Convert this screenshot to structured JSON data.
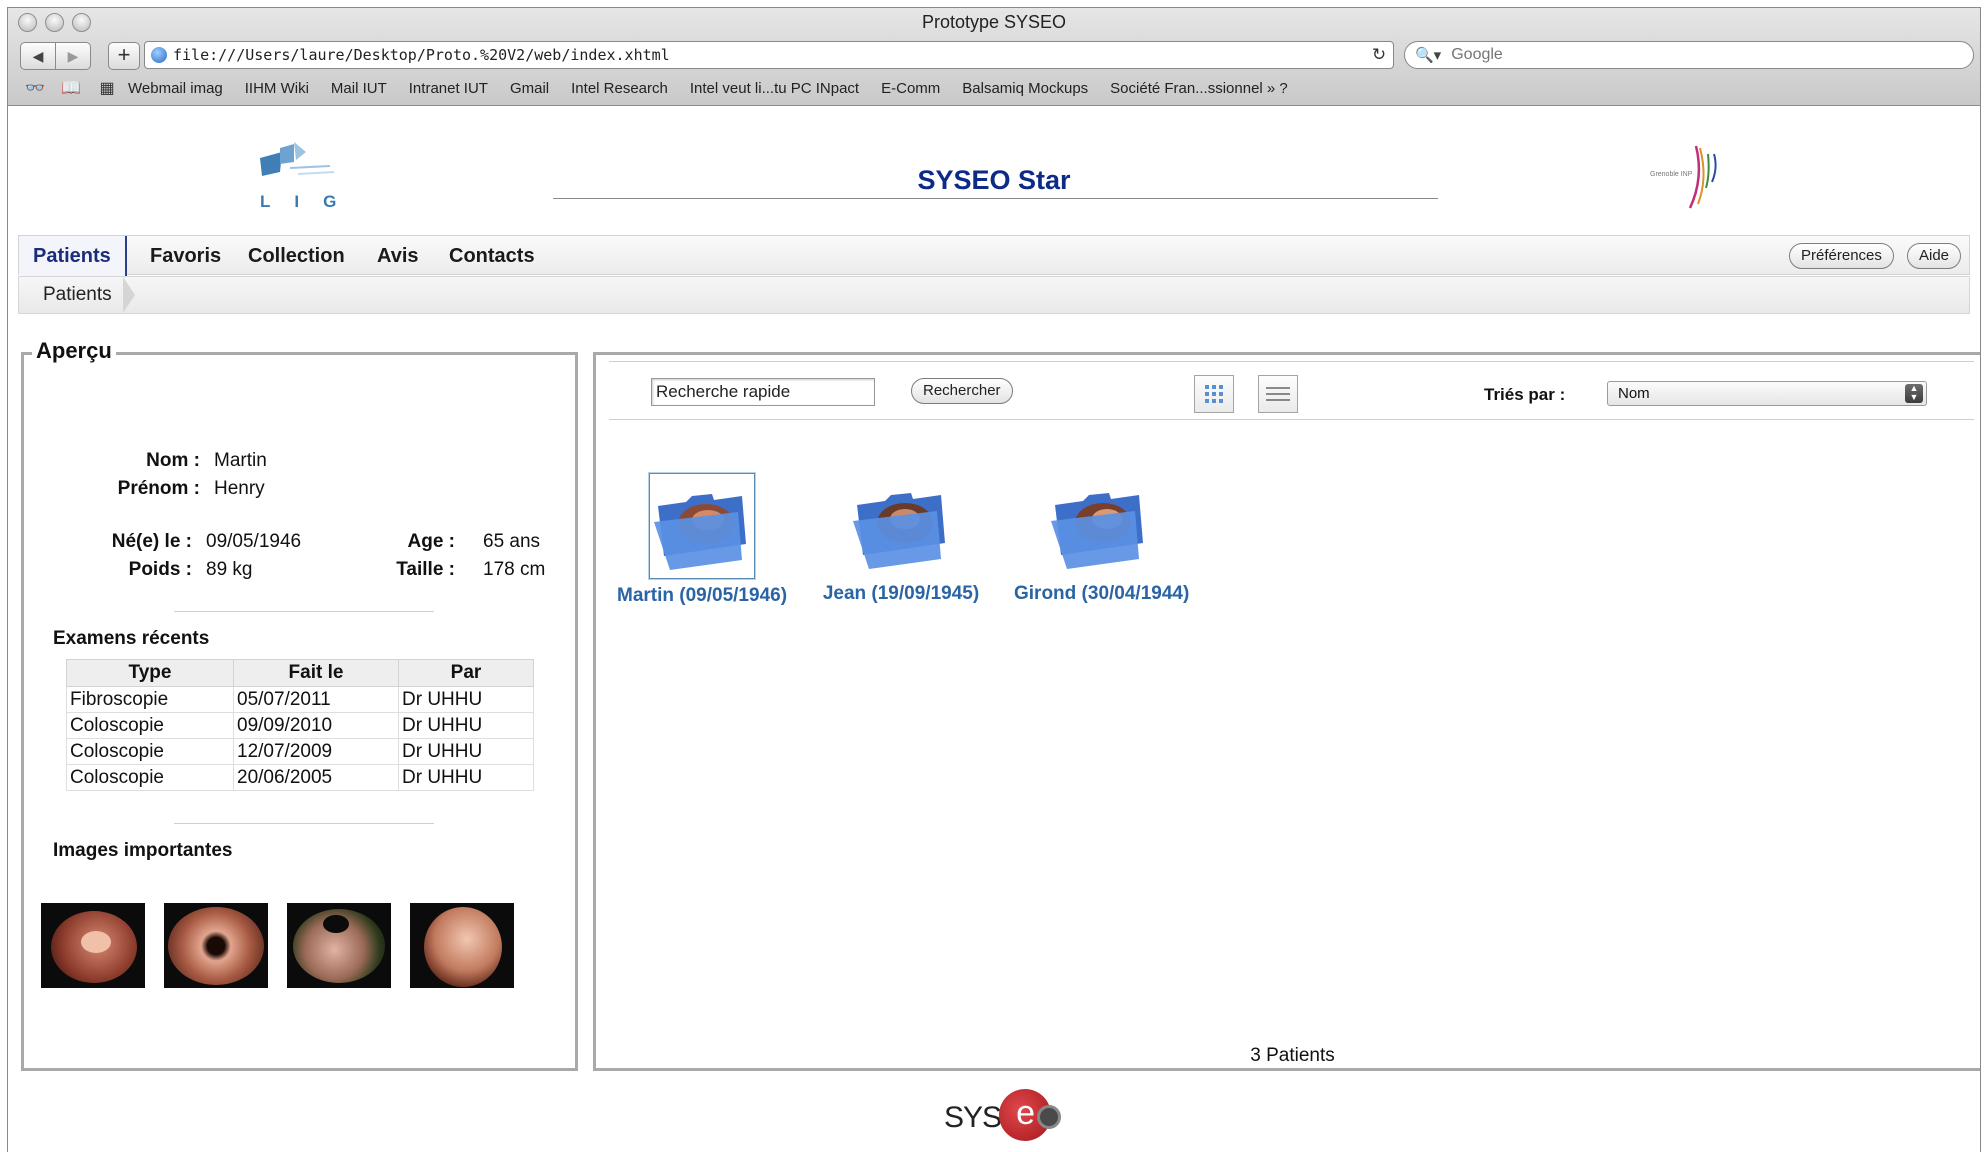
{
  "browser": {
    "window_title": "Prototype SYSEO",
    "url": "file:///Users/laure/Desktop/Proto.%20V2/web/index.xhtml",
    "search_placeholder": "Google",
    "bookmarks": [
      "Webmail imag",
      "IIHM Wiki",
      "Mail IUT",
      "Intranet IUT",
      "Gmail",
      "Intel Research",
      "Intel veut li...tu PC INpact",
      "E-Comm",
      "Balsamiq Mockups",
      "Société Fran...ssionnel » ?"
    ]
  },
  "header": {
    "logo_letters": "LIG",
    "title": "SYSEO Star",
    "right_logo_text": "Grenoble INP"
  },
  "menu": {
    "tabs": [
      "Patients",
      "Favoris",
      "Collection",
      "Avis",
      "Contacts"
    ],
    "active_tab": "Patients",
    "preferences_label": "Préférences",
    "help_label": "Aide"
  },
  "breadcrumb": [
    "Patients"
  ],
  "apercu": {
    "legend": "Aperçu",
    "nom_label": "Nom :",
    "nom_value": "Martin",
    "prenom_label": "Prénom :",
    "prenom_value": "Henry",
    "ne_label": "Né(e) le :",
    "ne_value": "09/05/1946",
    "age_label": "Age :",
    "age_value": "65 ans",
    "poids_label": "Poids :",
    "poids_value": "89 kg",
    "taille_label": "Taille :",
    "taille_value": "178 cm",
    "examens_heading": "Examens récents",
    "exam_columns": [
      "Type",
      "Fait le",
      "Par"
    ],
    "exams": [
      {
        "type": "Fibroscopie",
        "date": "05/07/2011",
        "par": "Dr UHHU"
      },
      {
        "type": "Coloscopie",
        "date": "09/09/2010",
        "par": "Dr UHHU"
      },
      {
        "type": "Coloscopie",
        "date": "12/07/2009",
        "par": "Dr UHHU"
      },
      {
        "type": "Coloscopie",
        "date": "20/06/2005",
        "par": "Dr UHHU"
      }
    ],
    "images_heading": "Images importantes"
  },
  "patients_panel": {
    "search_value": "Recherche rapide",
    "search_button": "Rechercher",
    "sort_label": "Triés par :",
    "sort_value": "Nom",
    "patients": [
      {
        "label": "Martin (09/05/1946)",
        "selected": true
      },
      {
        "label": "Jean (19/09/1945)",
        "selected": false
      },
      {
        "label": "Girond (30/04/1944)",
        "selected": false
      }
    ],
    "count_text": "3 Patients"
  },
  "footer": {
    "logo_prefix": "SYS",
    "logo_e": "e"
  },
  "colors": {
    "title_blue": "#0d2a86",
    "folder_label_blue": "#2a64a4",
    "panel_border": "#a9a9a9"
  }
}
